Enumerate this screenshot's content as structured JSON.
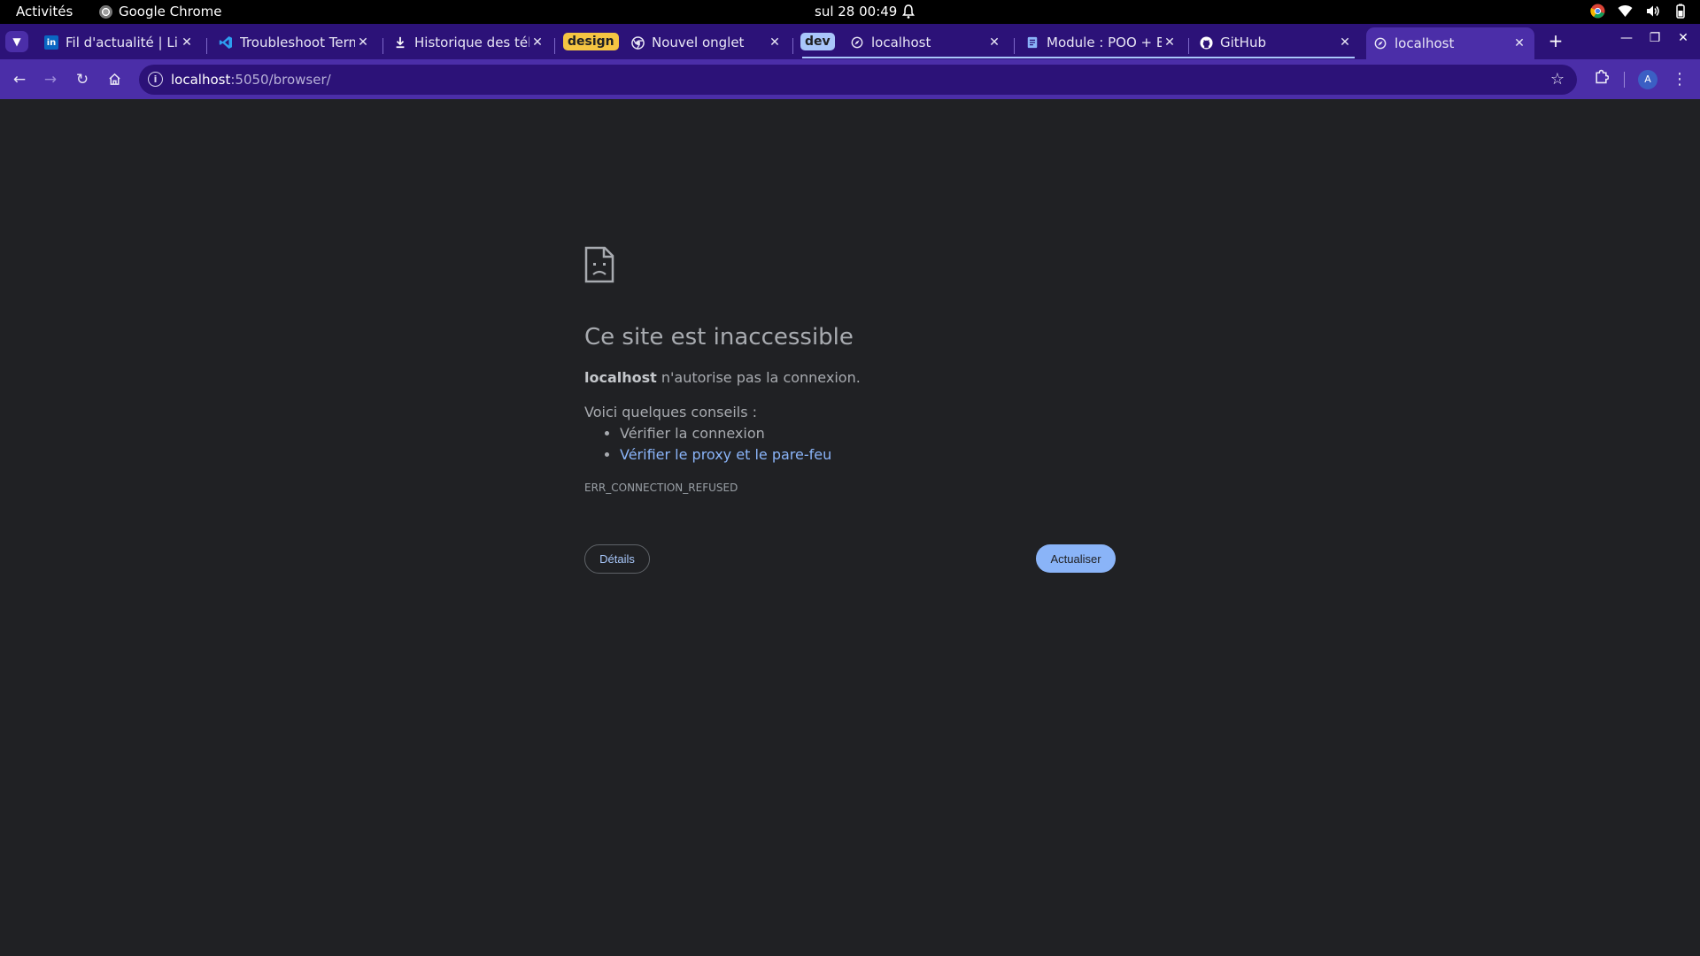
{
  "system_bar": {
    "activities": "Activités",
    "app_name": "Google Chrome",
    "clock": "sul 28  00:49"
  },
  "tabs": [
    {
      "label": "Fil d'actualité | Lin",
      "icon": "linkedin-icon"
    },
    {
      "label": "Troubleshoot Term",
      "icon": "vscode-icon"
    },
    {
      "label": "Historique des télé",
      "icon": "download-icon"
    },
    {
      "group": "design"
    },
    {
      "label": "Nouvel onglet",
      "icon": "chrome-icon"
    },
    {
      "group": "dev"
    },
    {
      "label": "localhost",
      "icon": "globe-icon"
    },
    {
      "label": "Module : POO + BD",
      "icon": "docs-icon"
    },
    {
      "label": "GitHub",
      "icon": "github-icon"
    },
    {
      "label": "localhost",
      "icon": "globe-icon",
      "active": true
    }
  ],
  "tab_groups": {
    "design": {
      "label": "design",
      "color": "#f5c542"
    },
    "dev": {
      "label": "dev",
      "color": "#a9c6fb"
    }
  },
  "omnibox": {
    "host": "localhost",
    "path": ":5050/browser/"
  },
  "profile": {
    "initial": "A"
  },
  "error_page": {
    "title": "Ce site est inaccessible",
    "host": "localhost",
    "message": " n'autorise pas la connexion.",
    "tips_heading": "Voici quelques conseils :",
    "tips": [
      "Vérifier la connexion",
      "Vérifier le proxy et le pare-feu"
    ],
    "error_code": "ERR_CONNECTION_REFUSED",
    "details_button": "Détails",
    "reload_button": "Actualiser"
  },
  "colors": {
    "page_bg": "#202124",
    "frame": "#2c1278",
    "toolbar": "#4b2ea8",
    "link": "#8ab4f8"
  }
}
